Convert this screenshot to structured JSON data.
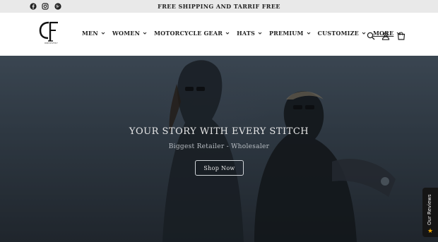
{
  "announcement": {
    "text": "FREE SHIPPING AND TARRIF FREE",
    "social_icons": [
      "facebook-icon",
      "instagram-icon",
      "pinterest-icon"
    ]
  },
  "header": {
    "logo_caption": "INDUSTRY",
    "nav": [
      {
        "label": "MEN",
        "has_dropdown": true
      },
      {
        "label": "WOMEN",
        "has_dropdown": true
      },
      {
        "label": "MOTORCYCLE GEAR",
        "has_dropdown": true
      },
      {
        "label": "HATS",
        "has_dropdown": true
      },
      {
        "label": "PREMIUM",
        "has_dropdown": true
      },
      {
        "label": "CUSTOMIZE",
        "has_dropdown": true
      },
      {
        "label": "MORE",
        "has_dropdown": true,
        "active": true
      }
    ],
    "icons": [
      "search-icon",
      "account-icon",
      "cart-icon"
    ]
  },
  "hero": {
    "title": "YOUR STORY WITH EVERY STITCH",
    "subtitle": "Biggest Retailer - Wholesaler",
    "button_label": "Shop Now"
  },
  "reviews_tab": {
    "label": "Our Reviews",
    "star": "★"
  },
  "colors": {
    "announcement_bg": "#e9e9e9",
    "hero_bg": "#3a4652",
    "reviews_bg": "#151515",
    "star": "#f0a800"
  }
}
